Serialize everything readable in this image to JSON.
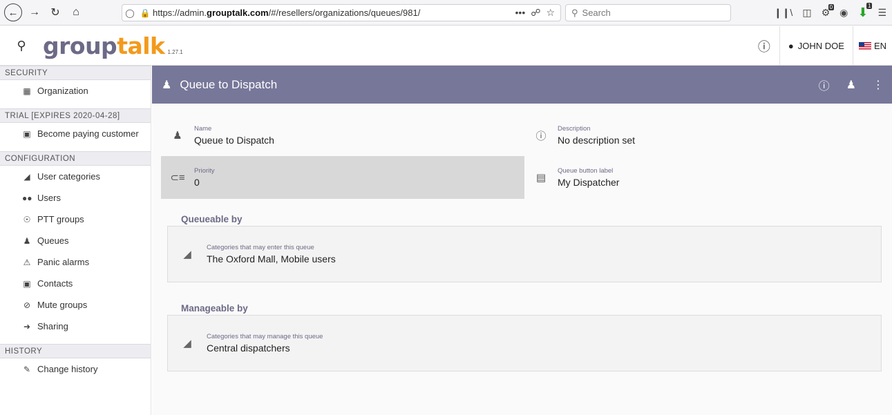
{
  "browser": {
    "url_prefix": "https://admin.",
    "url_domain": "grouptalk.com",
    "url_path": "/#/resellers/organizations/queues/981/",
    "search_placeholder": "Search",
    "menu_dots": "•••",
    "ext_badge_1": "0",
    "ext_badge_2": "1"
  },
  "app": {
    "logo_group": "group",
    "logo_talk": "talk",
    "version": "1.27.1",
    "user_name": "JOHN DOE",
    "language": "EN"
  },
  "sidebar": {
    "sections": [
      {
        "title": "SECURITY",
        "items": [
          {
            "label": "Organization",
            "icon": "building-icon"
          }
        ]
      },
      {
        "title": "TRIAL [EXPIRES 2020-04-28]",
        "items": [
          {
            "label": "Become paying customer",
            "icon": "money-icon"
          }
        ]
      },
      {
        "title": "CONFIGURATION",
        "items": [
          {
            "label": "User categories",
            "icon": "categories-icon"
          },
          {
            "label": "Users",
            "icon": "users-icon"
          },
          {
            "label": "PTT groups",
            "icon": "globe-icon"
          },
          {
            "label": "Queues",
            "icon": "queue-icon"
          },
          {
            "label": "Panic alarms",
            "icon": "alarm-icon"
          },
          {
            "label": "Contacts",
            "icon": "contacts-icon"
          },
          {
            "label": "Mute groups",
            "icon": "mute-icon"
          },
          {
            "label": "Sharing",
            "icon": "share-icon"
          }
        ]
      },
      {
        "title": "HISTORY",
        "items": [
          {
            "label": "Change history",
            "icon": "pencil-icon"
          }
        ]
      }
    ]
  },
  "page": {
    "title": "Queue to Dispatch",
    "fields": {
      "name_label": "Name",
      "name_value": "Queue to Dispatch",
      "description_label": "Description",
      "description_value": "No description set",
      "priority_label": "Priority",
      "priority_value": "0",
      "button_label_label": "Queue button label",
      "button_label_value": "My Dispatcher"
    },
    "queueable": {
      "title": "Queueable by",
      "label": "Categories that may enter this queue",
      "value": "The Oxford Mall, Mobile users"
    },
    "manageable": {
      "title": "Manageable by",
      "label": "Categories that may manage this queue",
      "value": "Central dispatchers"
    }
  },
  "colors": {
    "header_bg": "#77779a",
    "accent_text": "#6c6a86",
    "logo_orange": "#f39a1c"
  }
}
